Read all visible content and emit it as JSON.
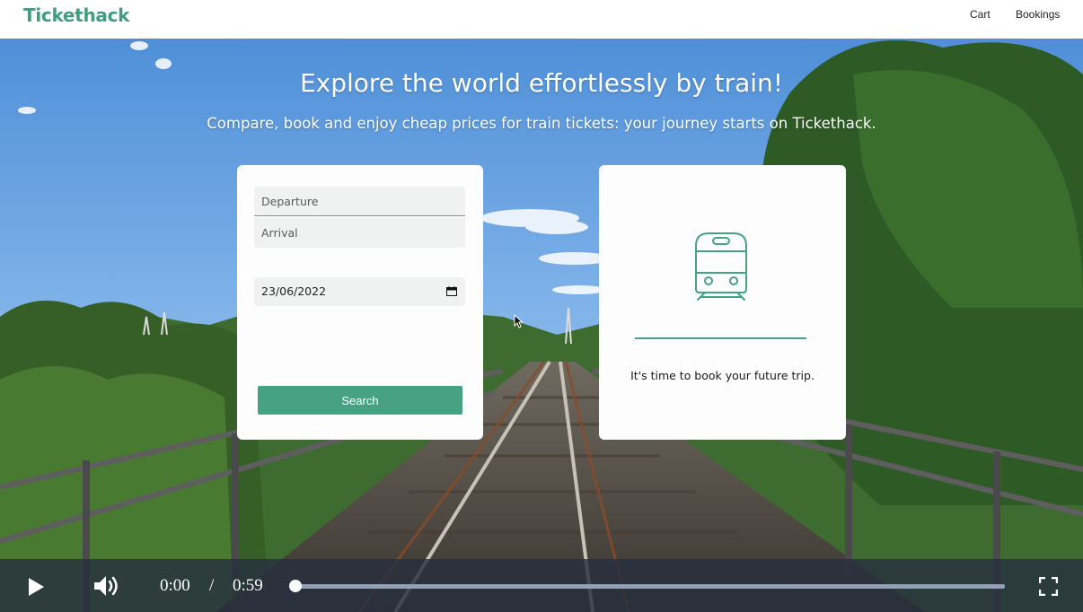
{
  "header": {
    "brand": "Tickethack",
    "nav": [
      {
        "label": "Cart"
      },
      {
        "label": "Bookings"
      }
    ]
  },
  "hero": {
    "title": "Explore the world effortlessly by train!",
    "subtitle": "Compare, book and enjoy cheap prices for train tickets: your journey starts on Tickethack."
  },
  "search": {
    "departure_placeholder": "Departure",
    "arrival_placeholder": "Arrival",
    "date_value": "23/06/2022",
    "button_label": "Search"
  },
  "result": {
    "icon": "train-icon",
    "message": "It's time to book your future trip."
  },
  "video": {
    "current_time": "0:00",
    "separator": "/",
    "duration": "0:59",
    "progress": 0
  },
  "colors": {
    "brand": "#3f9e7d",
    "button": "#46a283",
    "card": "#fdfdfd",
    "field": "#f0f1f1"
  }
}
